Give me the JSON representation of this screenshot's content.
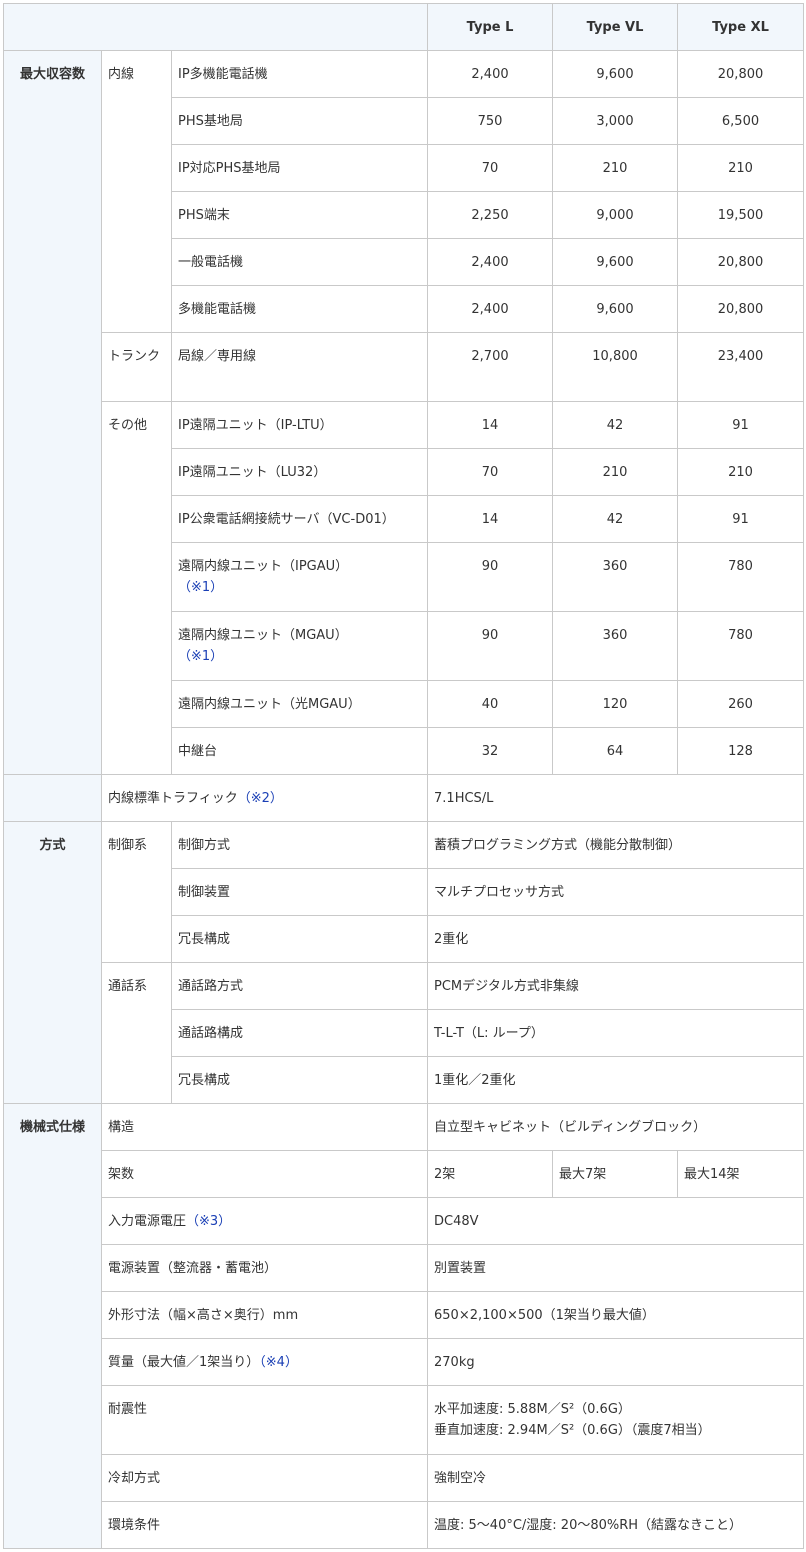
{
  "header": [
    "Type L",
    "Type VL",
    "Type XL"
  ],
  "capacity": {
    "category": "最大収容数",
    "ext_group": "内線",
    "ext_rows": [
      {
        "label": "IP多機能電話機",
        "values": [
          "2,400",
          "9,600",
          "20,800"
        ]
      },
      {
        "label": "PHS基地局",
        "values": [
          "750",
          "3,000",
          "6,500"
        ]
      },
      {
        "label": "IP対応PHS基地局",
        "values": [
          "70",
          "210",
          "210"
        ]
      },
      {
        "label": "PHS端末",
        "values": [
          "2,250",
          "9,000",
          "19,500"
        ]
      },
      {
        "label": "一般電話機",
        "values": [
          "2,400",
          "9,600",
          "20,800"
        ]
      },
      {
        "label": "多機能電話機",
        "values": [
          "2,400",
          "9,600",
          "20,800"
        ]
      }
    ],
    "trunk_group": "トランク",
    "trunk_row": {
      "label": "局線／専用線",
      "values": [
        "2,700",
        "10,800",
        "23,400"
      ]
    },
    "other_group": "その他",
    "other_rows": [
      {
        "label": "IP遠隔ユニット（IP-LTU）",
        "note": "",
        "values": [
          "14",
          "42",
          "91"
        ]
      },
      {
        "label": "IP遠隔ユニット（LU32）",
        "note": "",
        "values": [
          "70",
          "210",
          "210"
        ]
      },
      {
        "label": "IP公衆電話網接続サーバ（VC-D01）",
        "note": "",
        "values": [
          "14",
          "42",
          "91"
        ]
      },
      {
        "label": "遠隔内線ユニット（IPGAU）",
        "note": "（※1）",
        "values": [
          "90",
          "360",
          "780"
        ]
      },
      {
        "label": "遠隔内線ユニット（MGAU）",
        "note": "（※1）",
        "values": [
          "90",
          "360",
          "780"
        ]
      },
      {
        "label": "遠隔内線ユニット（光MGAU）",
        "note": "",
        "values": [
          "40",
          "120",
          "260"
        ]
      },
      {
        "label": "中継台",
        "note": "",
        "values": [
          "32",
          "64",
          "128"
        ]
      }
    ],
    "traffic": {
      "label": "内線標準トラフィック",
      "note": "（※2）",
      "value": "7.1HCS/L"
    }
  },
  "method": {
    "category": "方式",
    "control_group": "制御系",
    "control_rows": [
      {
        "label": "制御方式",
        "value": "蓄積プログラミング方式（機能分散制御）"
      },
      {
        "label": "制御装置",
        "value": "マルチプロセッサ方式"
      },
      {
        "label": "冗長構成",
        "value": "2重化"
      }
    ],
    "call_group": "通話系",
    "call_rows": [
      {
        "label": "通話路方式",
        "value": "PCMデジタル方式非集線"
      },
      {
        "label": "通話路構成",
        "value": "T-L-T（L: ループ）"
      },
      {
        "label": "冗長構成",
        "value": "1重化／2重化"
      }
    ]
  },
  "mech": {
    "category": "機械式仕様",
    "structure": {
      "label": "構造",
      "value": "自立型キャビネット（ビルディングブロック）"
    },
    "racks": {
      "label": "架数",
      "values": [
        "2架",
        "最大7架",
        "最大14架"
      ]
    },
    "voltage": {
      "label": "入力電源電圧",
      "note": "（※3）",
      "value": "DC48V"
    },
    "power": {
      "label": "電源装置（整流器・蓄電池）",
      "value": "別置装置"
    },
    "dimensions": {
      "label": "外形寸法（幅×高さ×奥行）mm",
      "value": "650×2,100×500（1架当り最大値）"
    },
    "weight": {
      "label": "質量（最大値／1架当り）",
      "note": "（※4）",
      "value": "270kg"
    },
    "seismic": {
      "label": "耐震性",
      "line1": "水平加速度: 5.88M／S²（0.6G）",
      "line2": "垂直加速度: 2.94M／S²（0.6G）（震度7相当）"
    },
    "cooling": {
      "label": "冷却方式",
      "value": "強制空冷"
    },
    "environment": {
      "label": "環境条件",
      "value": "温度: 5～40°C/湿度: 20～80%RH（結露なきこと）"
    }
  }
}
